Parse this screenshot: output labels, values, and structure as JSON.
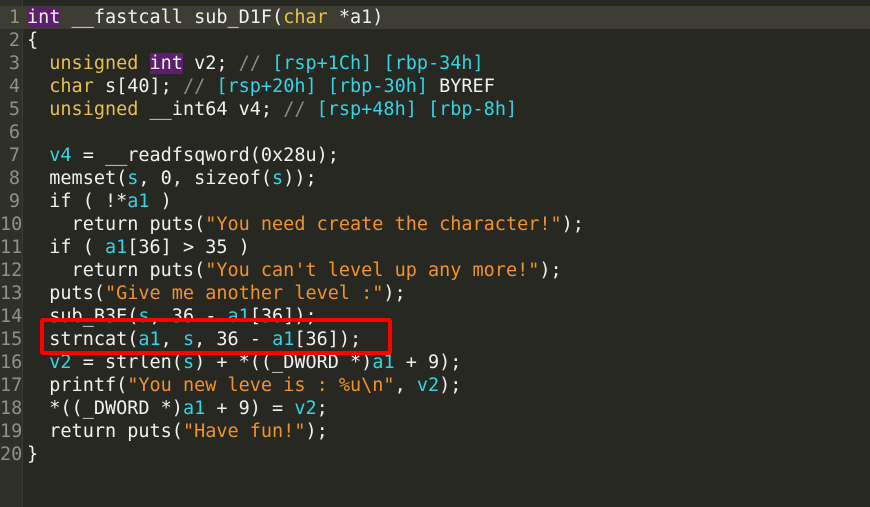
{
  "editor": {
    "lines": [
      {
        "num": "1",
        "segments": [
          [
            "kwint",
            "int"
          ],
          [
            "p",
            " __fastcall sub_D1F("
          ],
          [
            "kw",
            "char"
          ],
          [
            "p",
            " *"
          ],
          [
            "p",
            "a1)"
          ]
        ]
      },
      {
        "num": "2",
        "segments": [
          [
            "p",
            "{"
          ]
        ]
      },
      {
        "num": "3",
        "segments": [
          [
            "p",
            "  "
          ],
          [
            "kw",
            "unsigned"
          ],
          [
            "p",
            " "
          ],
          [
            "kwint",
            "int"
          ],
          [
            "p",
            " v2; "
          ],
          [
            "c",
            "// "
          ],
          [
            "cv",
            "[rsp+1Ch] [rbp-34h]"
          ]
        ]
      },
      {
        "num": "4",
        "segments": [
          [
            "p",
            "  "
          ],
          [
            "kw",
            "char"
          ],
          [
            "p",
            " s[40]; "
          ],
          [
            "c",
            "// "
          ],
          [
            "cv",
            "[rsp+20h] [rbp-30h]"
          ],
          [
            "p",
            " BYREF"
          ]
        ]
      },
      {
        "num": "5",
        "segments": [
          [
            "p",
            "  "
          ],
          [
            "kw",
            "unsigned"
          ],
          [
            "p",
            " __int64 v4; "
          ],
          [
            "c",
            "// "
          ],
          [
            "cv",
            "[rsp+48h] [rbp-8h]"
          ]
        ]
      },
      {
        "num": "6",
        "segments": [
          [
            "p",
            ""
          ]
        ]
      },
      {
        "num": "7",
        "segments": [
          [
            "p",
            "  "
          ],
          [
            "v",
            "v4"
          ],
          [
            "p",
            " = __readfsqword(0x28u);"
          ]
        ]
      },
      {
        "num": "8",
        "segments": [
          [
            "p",
            "  memset("
          ],
          [
            "v",
            "s"
          ],
          [
            "p",
            ", 0, sizeof("
          ],
          [
            "v",
            "s"
          ],
          [
            "p",
            "));"
          ]
        ]
      },
      {
        "num": "9",
        "segments": [
          [
            "p",
            "  if ( !*"
          ],
          [
            "v",
            "a1"
          ],
          [
            "p",
            " )"
          ]
        ]
      },
      {
        "num": "10",
        "segments": [
          [
            "p",
            "    return puts("
          ],
          [
            "s",
            "\"You need create the character!\""
          ],
          [
            "p",
            ");"
          ]
        ]
      },
      {
        "num": "11",
        "segments": [
          [
            "p",
            "  if ( "
          ],
          [
            "v",
            "a1"
          ],
          [
            "p",
            "[36] > 35 )"
          ]
        ]
      },
      {
        "num": "12",
        "segments": [
          [
            "p",
            "    return puts("
          ],
          [
            "s",
            "\"You can't level up any more!\""
          ],
          [
            "p",
            ");"
          ]
        ]
      },
      {
        "num": "13",
        "segments": [
          [
            "p",
            "  puts("
          ],
          [
            "s",
            "\"Give me another level :\""
          ],
          [
            "p",
            ");"
          ]
        ]
      },
      {
        "num": "14",
        "segments": [
          [
            "p",
            "  sub_B3E("
          ],
          [
            "v",
            "s"
          ],
          [
            "p",
            ", 36 - "
          ],
          [
            "v",
            "a1"
          ],
          [
            "p",
            "[36]);"
          ]
        ]
      },
      {
        "num": "15",
        "segments": [
          [
            "p",
            "  strncat("
          ],
          [
            "v",
            "a1"
          ],
          [
            "p",
            ", "
          ],
          [
            "v",
            "s"
          ],
          [
            "p",
            ", 36 - "
          ],
          [
            "v",
            "a1"
          ],
          [
            "p",
            "[36]);"
          ]
        ]
      },
      {
        "num": "16",
        "segments": [
          [
            "p",
            "  "
          ],
          [
            "v",
            "v2"
          ],
          [
            "p",
            " = strlen("
          ],
          [
            "v",
            "s"
          ],
          [
            "p",
            ") + *((_DWORD *)"
          ],
          [
            "v",
            "a1"
          ],
          [
            "p",
            " + 9);"
          ]
        ]
      },
      {
        "num": "17",
        "segments": [
          [
            "p",
            "  printf("
          ],
          [
            "s",
            "\"You new leve is : %u\\n\""
          ],
          [
            "p",
            ", "
          ],
          [
            "v",
            "v2"
          ],
          [
            "p",
            ");"
          ]
        ]
      },
      {
        "num": "18",
        "segments": [
          [
            "p",
            "  *((_DWORD *)"
          ],
          [
            "v",
            "a1"
          ],
          [
            "p",
            " + 9) = "
          ],
          [
            "v",
            "v2"
          ],
          [
            "p",
            ";"
          ]
        ]
      },
      {
        "num": "19",
        "segments": [
          [
            "p",
            "  return puts("
          ],
          [
            "s",
            "\"Have fun!\""
          ],
          [
            "p",
            ");"
          ]
        ]
      },
      {
        "num": "20",
        "segments": [
          [
            "p",
            "}"
          ]
        ]
      }
    ]
  },
  "highlight": {
    "color": "#ff0000",
    "target_line": "15"
  }
}
